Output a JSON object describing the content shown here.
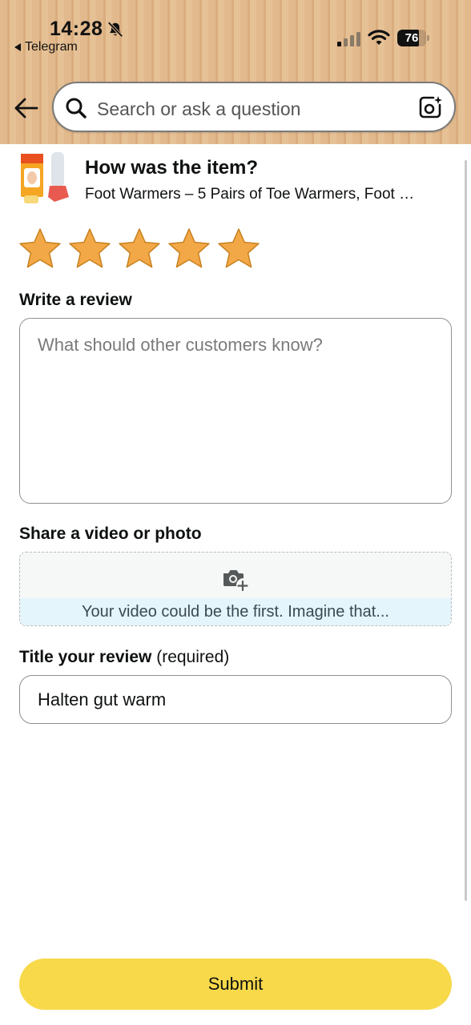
{
  "status_bar": {
    "time": "14:28",
    "back_app": "Telegram",
    "battery": "76",
    "battery_level": 0.76
  },
  "search": {
    "placeholder": "Search or ask a question"
  },
  "product": {
    "question": "How was the item?",
    "title": "Foot Warmers – 5 Pairs of Toe Warmers, Foot …"
  },
  "rating": {
    "value": 5,
    "max": 5,
    "star_color": "#f3a847"
  },
  "review": {
    "label": "Write a review",
    "placeholder": "What should other customers know?",
    "value": ""
  },
  "media": {
    "label": "Share a video or photo",
    "prompt": "Your video could be the first. Imagine that..."
  },
  "title_field": {
    "label": "Title your review",
    "label_suffix": "(required)",
    "value": "Halten gut warm"
  },
  "submit": {
    "label": "Submit",
    "color": "#f7d94a"
  },
  "icons": {
    "bell_off": "bell-off-icon",
    "signal": "signal-icon",
    "wifi": "wifi-icon",
    "back": "back-arrow-icon",
    "search": "search-icon",
    "camera_ai": "camera-sparkle-icon",
    "upload_camera": "camera-plus-icon"
  }
}
